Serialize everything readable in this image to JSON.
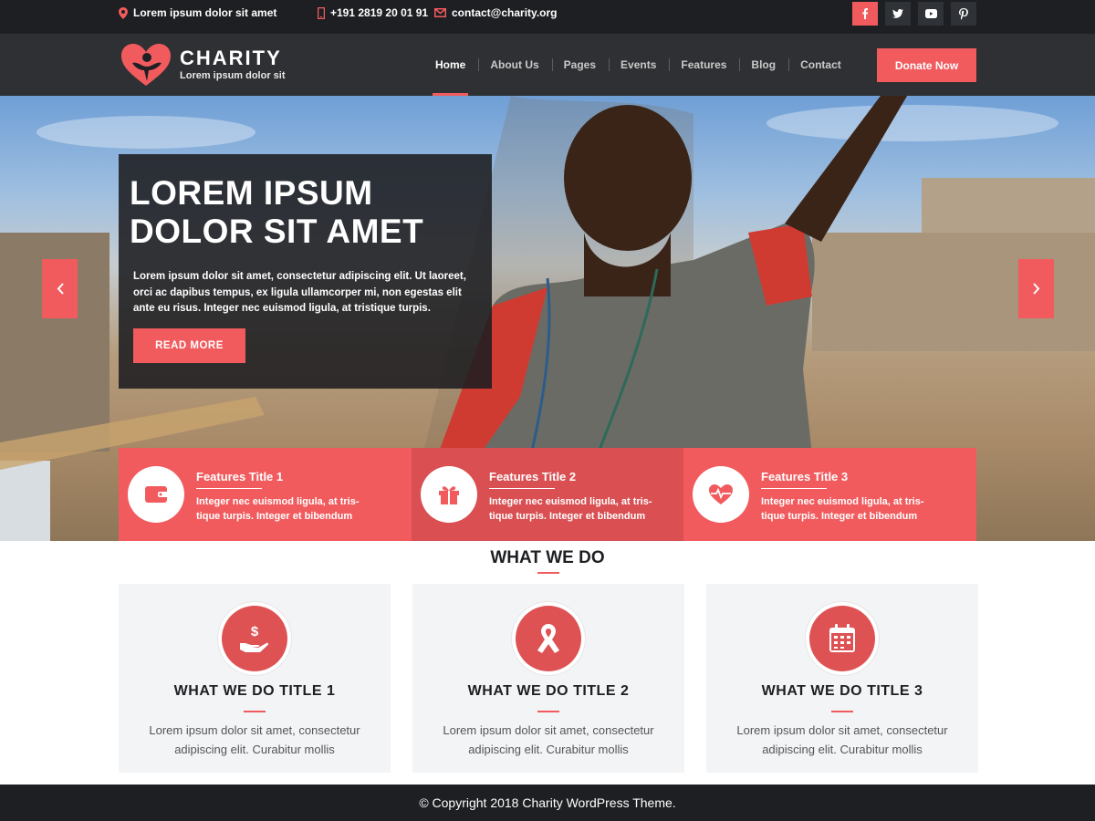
{
  "topbar": {
    "address": "Lorem ipsum dolor sit amet",
    "phone": "+191 2819 20 01 91",
    "email": "contact@charity.org",
    "socials": [
      "facebook-icon",
      "twitter-icon",
      "youtube-icon",
      "pinterest-icon"
    ]
  },
  "header": {
    "logo_title": "CHARITY",
    "logo_tagline": "Lorem ipsum dolor sit",
    "nav": [
      "Home",
      "About Us",
      "Pages",
      "Events",
      "Features",
      "Blog",
      "Contact"
    ],
    "active_nav": "Home",
    "donate_label": "Donate Now"
  },
  "hero": {
    "title": "LOREM IPSUM DOLOR SIT AMET",
    "text": "Lorem ipsum dolor sit amet, consectetur adipiscing elit. Ut laoreet, orci ac dapibus tempus, ex ligula ullamcorper mi, non egestas elit ante eu risus. Integer nec euismod ligula, at tristique turpis.",
    "button_label": "READ MORE"
  },
  "features": [
    {
      "title": "Features Title 1",
      "desc": "Integer nec euismod ligula, at tris-tique turpis. Integer et bibendum",
      "icon": "wallet-icon"
    },
    {
      "title": "Features Title 2",
      "desc": "Integer nec euismod ligula, at tris-tique turpis. Integer et bibendum",
      "icon": "gift-icon"
    },
    {
      "title": "Features Title 3",
      "desc": "Integer nec euismod ligula, at tris-tique turpis. Integer et bibendum",
      "icon": "heartbeat-icon"
    }
  ],
  "what_we_do": {
    "heading": "WHAT WE DO",
    "cards": [
      {
        "title": "WHAT WE DO TITLE 1",
        "text": "Lorem ipsum dolor sit amet, consectetur adipiscing elit. Curabitur mollis",
        "icon": "donation-hand-icon"
      },
      {
        "title": "WHAT WE DO TITLE 2",
        "text": "Lorem ipsum dolor sit amet, consectetur adipiscing elit. Curabitur mollis",
        "icon": "ribbon-icon"
      },
      {
        "title": "WHAT WE DO TITLE 3",
        "text": "Lorem ipsum dolor sit amet, consectetur adipiscing elit. Curabitur mollis",
        "icon": "calendar-icon"
      }
    ]
  },
  "footer": {
    "copyright": "© Copyright 2018 Charity WordPress Theme."
  },
  "colors": {
    "accent": "#f15b5e",
    "dark": "#1d1f22"
  }
}
